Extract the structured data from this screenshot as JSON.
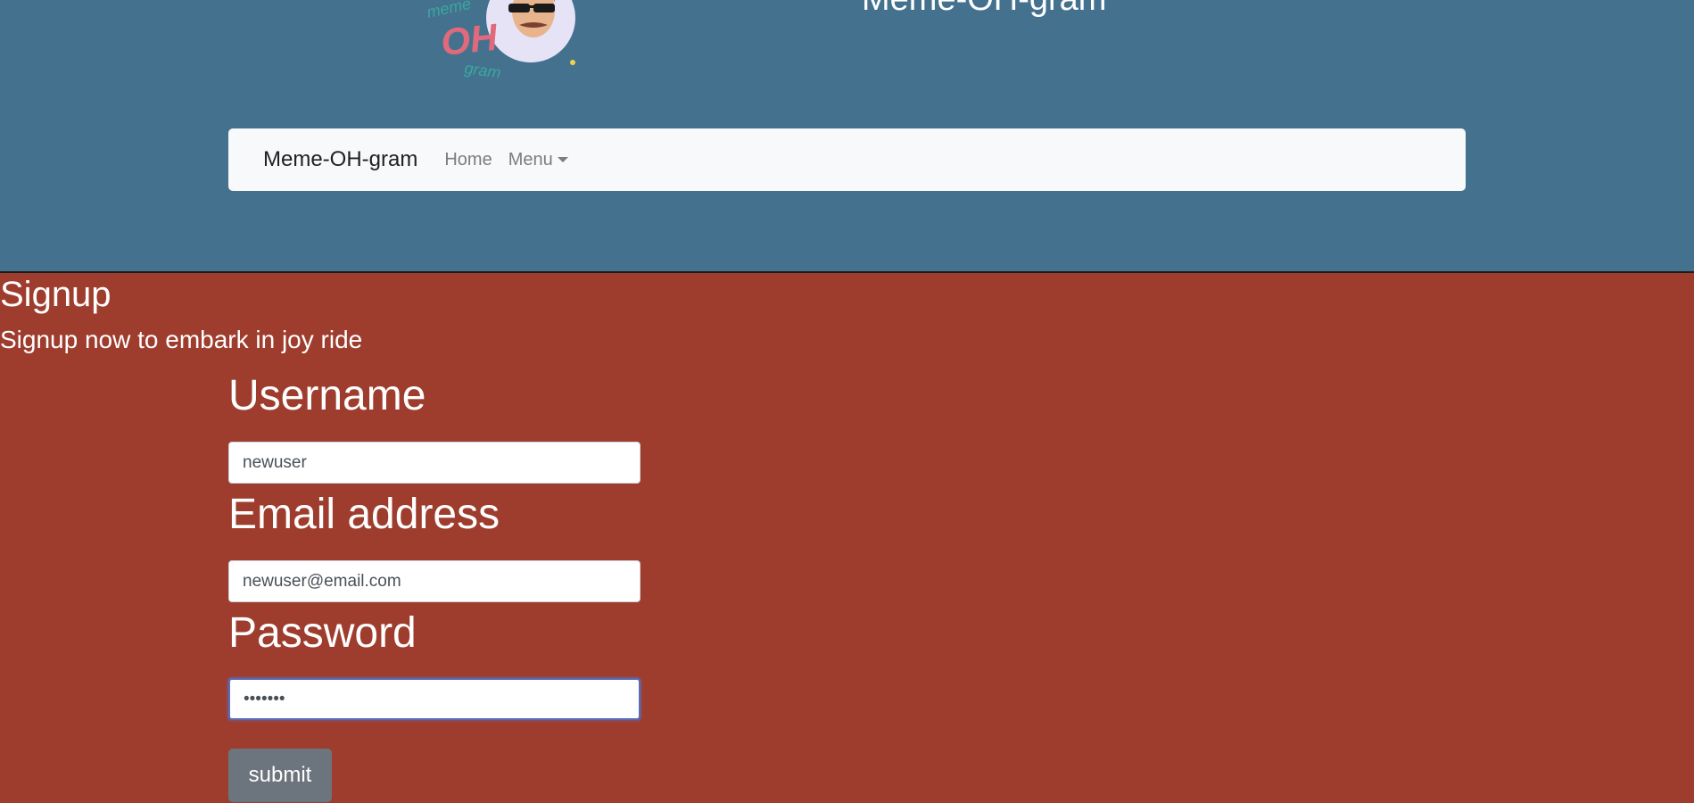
{
  "site": {
    "title": "Meme-OH-gram",
    "logo_text_top": "meme",
    "logo_text_mid": "OH",
    "logo_text_bottom": "gram"
  },
  "navbar": {
    "brand": "Meme-OH-gram",
    "home_label": "Home",
    "menu_label": "Menu"
  },
  "signup": {
    "title": "Signup",
    "subtitle": "Signup now to embark in joy ride"
  },
  "form": {
    "username_label": "Username",
    "username_value": "newuser",
    "email_label": "Email address",
    "email_value": "newuser@email.com",
    "password_label": "Password",
    "password_value": "•••••••",
    "submit_label": "submit"
  },
  "colors": {
    "header_bg": "#44728e",
    "body_bg": "#9e3d2e",
    "navbar_bg": "#f8f9fa",
    "button_bg": "#6c757d"
  }
}
